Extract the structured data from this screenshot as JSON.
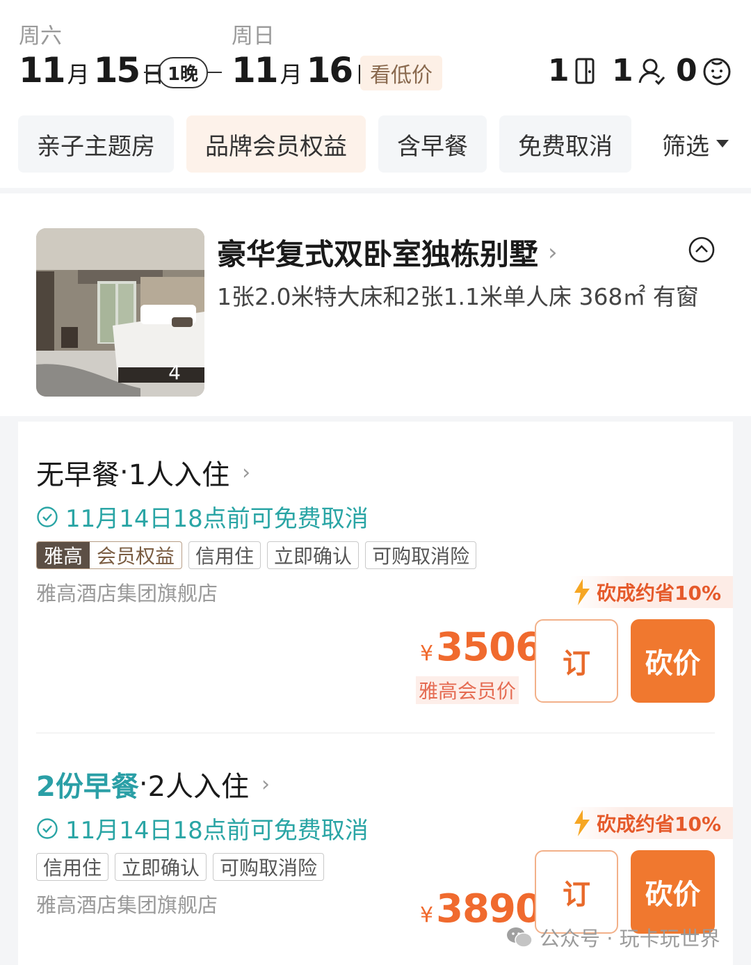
{
  "header": {
    "checkin": {
      "weekday": "周六",
      "month": "11",
      "month_unit": "月",
      "day": "15",
      "day_unit": "日"
    },
    "checkout": {
      "weekday": "周日",
      "month": "11",
      "month_unit": "月",
      "day": "16",
      "day_unit": "日"
    },
    "nights": "1晚",
    "low_price_label": "看低价",
    "rooms": "1",
    "adults": "1",
    "children": "0"
  },
  "filters": [
    {
      "label": "亲子主题房"
    },
    {
      "label": "品牌会员权益"
    },
    {
      "label": "含早餐"
    },
    {
      "label": "免费取消"
    },
    {
      "label": "筛选"
    }
  ],
  "room": {
    "title": "豪华复式双卧室独栋别墅",
    "spec": "1张2.0米特大床和2张1.1米单人床  368㎡  有窗",
    "photo_count": "4"
  },
  "rates": [
    {
      "plan_main": "无早餐",
      "plan_sep": " · ",
      "plan_guests": "1人入住",
      "cancel": "11月14日18点前可免费取消",
      "member_tag": {
        "brand": "雅高",
        "benefit": "会员权益"
      },
      "tags": [
        "信用住",
        "立即确认",
        "可购取消险"
      ],
      "seller": "雅高酒店集团旗舰店",
      "save": "砍成约省10%",
      "currency": "¥",
      "price": "3506",
      "price_label": "雅高会员价",
      "book_label": "订",
      "bargain_label": "砍价"
    },
    {
      "plan_main": "2份早餐",
      "plan_sep": " · ",
      "plan_guests": "2人入住",
      "cancel": "11月14日18点前可免费取消",
      "tags": [
        "信用住",
        "立即确认",
        "可购取消险"
      ],
      "seller": "雅高酒店集团旗舰店",
      "save": "砍成约省10%",
      "currency": "¥",
      "price": "3890",
      "book_label": "订",
      "bargain_label": "砍价"
    }
  ],
  "watermark": {
    "text": "公众号 · 玩卡玩世界"
  },
  "colors": {
    "accent": "#f0782f",
    "price": "#f06a2e",
    "teal": "#2aa5a5"
  }
}
